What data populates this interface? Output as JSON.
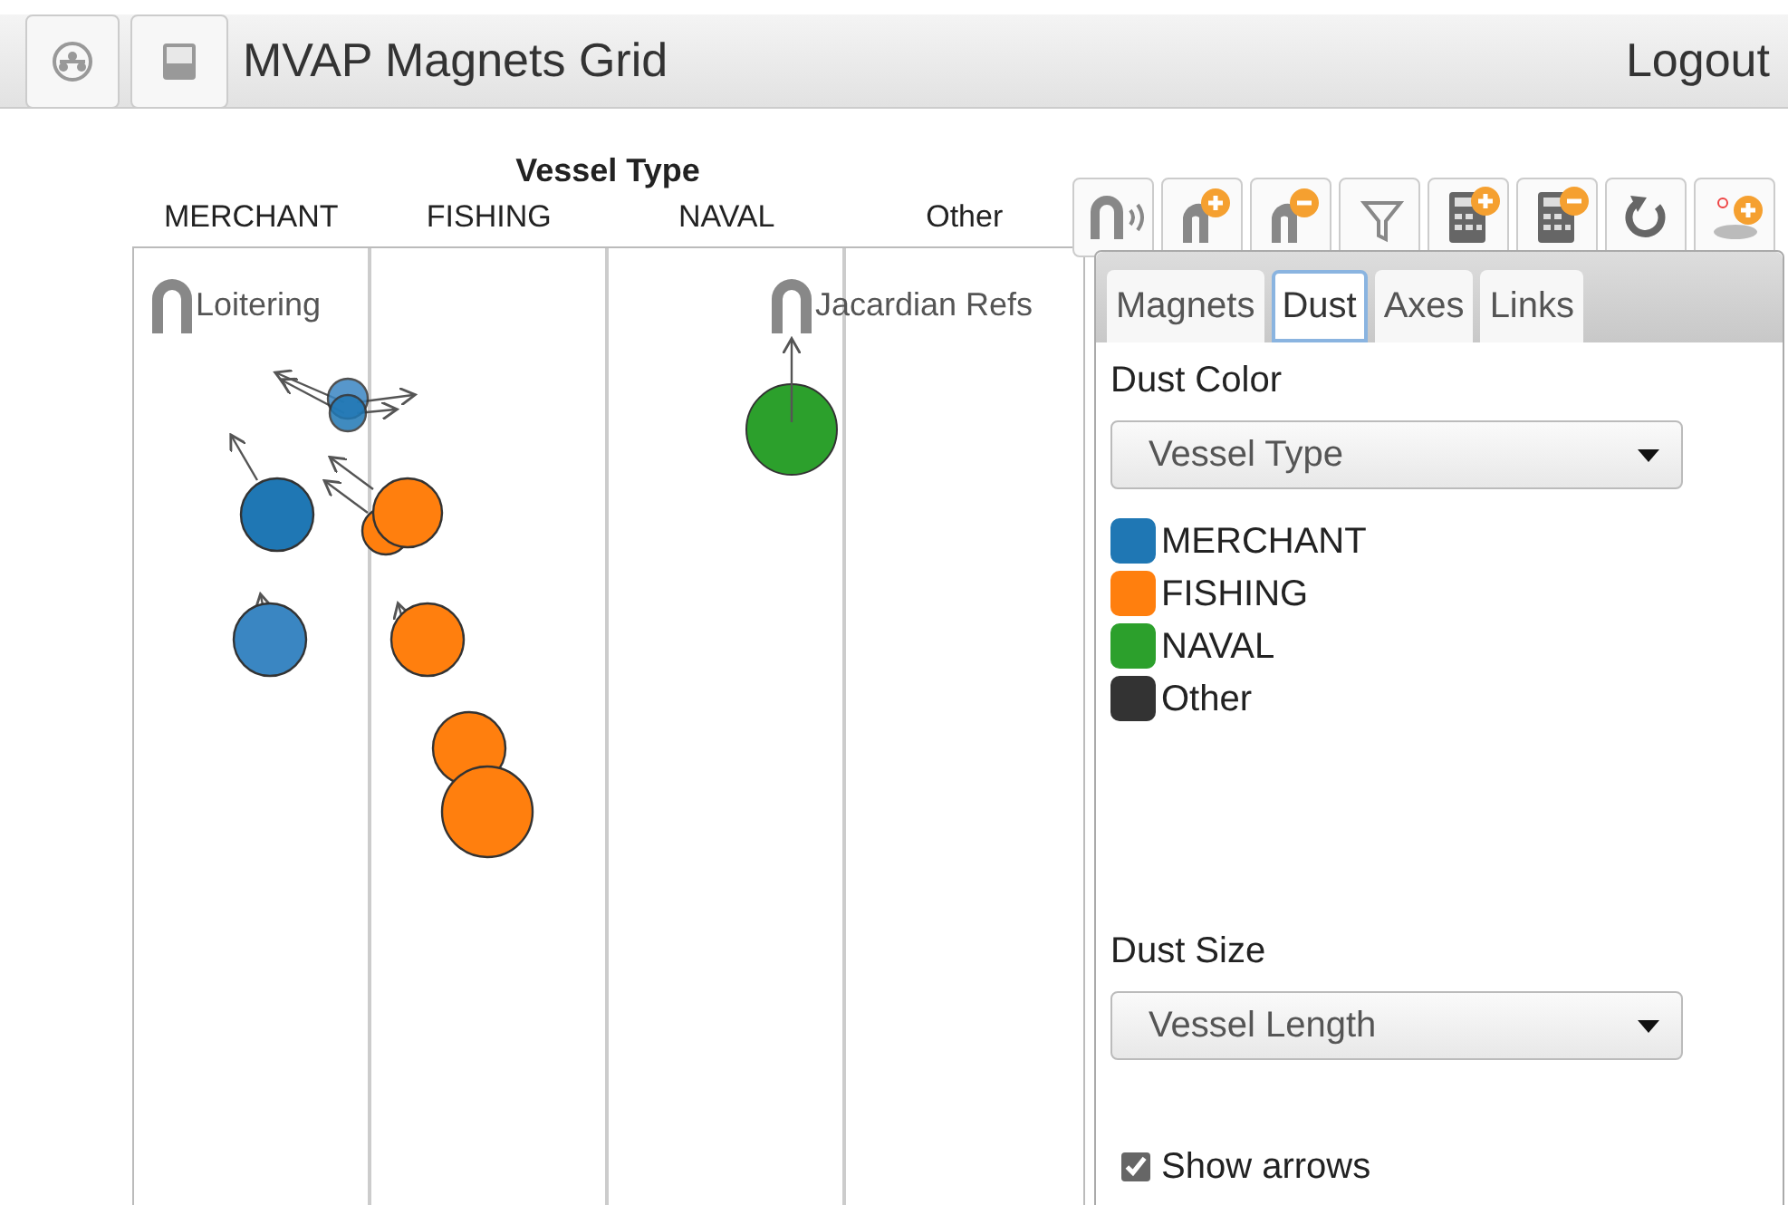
{
  "header": {
    "title": "MVAP Magnets Grid",
    "logout": "Logout"
  },
  "grid": {
    "axis_title": "Vessel Type",
    "columns": [
      "MERCHANT",
      "FISHING",
      "NAVAL",
      "Other"
    ],
    "magnets": [
      {
        "label": "Loitering"
      },
      {
        "label": "Jacardian Refs"
      }
    ]
  },
  "tabs": [
    {
      "label": "Magnets",
      "selected": false
    },
    {
      "label": "Dust",
      "selected": true
    },
    {
      "label": "Axes",
      "selected": false
    },
    {
      "label": "Links",
      "selected": false
    }
  ],
  "dust_color": {
    "label": "Dust Color",
    "value": "Vessel Type",
    "legend": [
      {
        "label": "MERCHANT",
        "color": "#1f77b4"
      },
      {
        "label": "FISHING",
        "color": "#ff7f0e"
      },
      {
        "label": "NAVAL",
        "color": "#2ca02c"
      },
      {
        "label": "Other",
        "color": "#333333"
      }
    ]
  },
  "dust_size": {
    "label": "Dust Size",
    "value": "Vessel Length"
  },
  "show_arrows": {
    "label": "Show arrows",
    "checked": true
  }
}
